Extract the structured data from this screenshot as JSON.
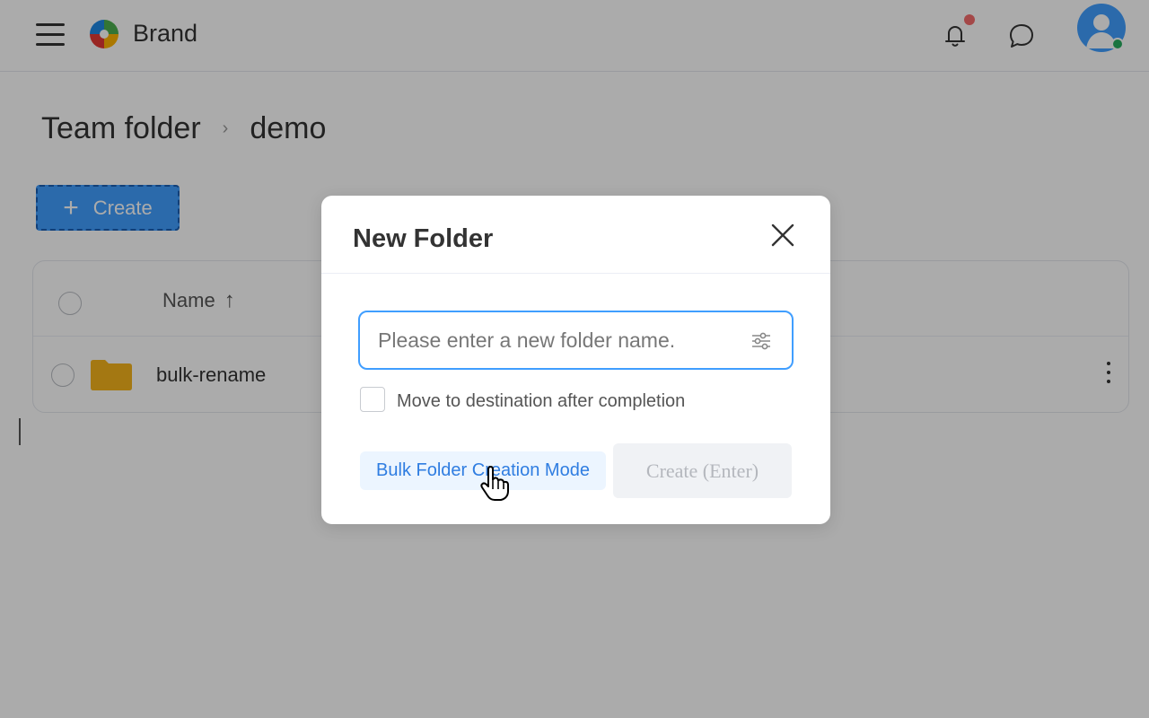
{
  "header": {
    "brand": "Brand",
    "icons": {
      "menu": "hamburger-icon",
      "logo": "brand-logo-icon",
      "notifications": "bell-icon",
      "messages": "chat-bubble-icon",
      "avatar": "user-avatar-icon"
    },
    "has_unread_notification": true,
    "user_online": true
  },
  "breadcrumb": {
    "items": [
      "Team folder",
      "demo"
    ],
    "separator": "›"
  },
  "toolbar": {
    "create_label": "Create",
    "create_icon": "+"
  },
  "table": {
    "columns": {
      "name": "Name",
      "sort_indicator": "↑"
    },
    "rows": [
      {
        "name": "bulk-rename",
        "type": "folder"
      }
    ]
  },
  "dialog": {
    "title": "New Folder",
    "input_placeholder": "Please enter a new folder name.",
    "input_value": "",
    "checkbox_label": "Move to destination after completion",
    "checkbox_checked": false,
    "bulk_mode_label": "Bulk Folder Creation Mode",
    "submit_label": "Create (Enter)",
    "submit_disabled": true
  },
  "colors": {
    "primary": "#409eff",
    "folder": "#f5b31b",
    "notification_dot": "#f56c6c",
    "online": "#27ae60",
    "overlay": "rgba(0,0,0,0.33)"
  }
}
